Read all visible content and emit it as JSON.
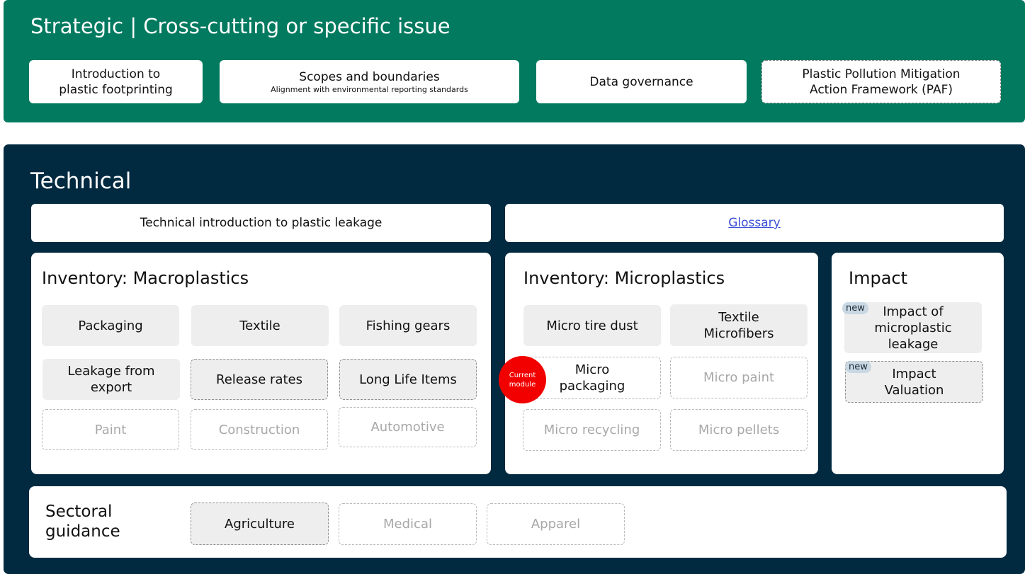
{
  "strategic": {
    "title": "Strategic | Cross-cutting or specific issue",
    "cards": [
      {
        "line1": "Introduction to",
        "line2": "plastic footprinting"
      },
      {
        "line1": "Scopes and boundaries",
        "sub": "Alignment with environmental reporting standards"
      },
      {
        "line1": "Data governance"
      },
      {
        "line1": "Plastic Pollution Mitigation",
        "line2": "Action Framework  (PAF)"
      }
    ]
  },
  "technical": {
    "title": "Technical",
    "intro": "Technical introduction to plastic leakage",
    "glossary": "Glossary",
    "macro": {
      "title": "Inventory: Macroplastics",
      "items": [
        {
          "l1": "Packaging"
        },
        {
          "l1": "Textile"
        },
        {
          "l1": "Fishing gears"
        },
        {
          "l1": "Leakage from",
          "l2": "export"
        },
        {
          "l1": "Release rates"
        },
        {
          "l1": "Long Life Items"
        },
        {
          "l1": "Paint"
        },
        {
          "l1": "Construction"
        },
        {
          "l1": "Automotive"
        }
      ]
    },
    "micro": {
      "title": "Inventory: Microplastics",
      "items": [
        {
          "l1": "Micro tire dust"
        },
        {
          "l1": "Textile",
          "l2": "Microfibers"
        },
        {
          "l1": "Micro",
          "l2": "packaging"
        },
        {
          "l1": "Micro paint"
        },
        {
          "l1": "Micro recycling"
        },
        {
          "l1": "Micro pellets"
        }
      ],
      "current_badge": {
        "l1": "Current",
        "l2": "module"
      }
    },
    "impact": {
      "title": "Impact",
      "items": [
        {
          "badge": "new",
          "l1": "Impact of",
          "l2": "microplastic",
          "l3": "leakage"
        },
        {
          "badge": "new",
          "l1": "Impact",
          "l2": "Valuation"
        }
      ]
    },
    "sectoral": {
      "title_l1": "Sectoral",
      "title_l2": "guidance",
      "items": [
        {
          "l1": "Agriculture"
        },
        {
          "l1": "Medical"
        },
        {
          "l1": "Apparel"
        }
      ]
    }
  },
  "colors": {
    "strategic_bg": "#027a5f",
    "technical_bg": "#012a40",
    "current_marker": "#f20000",
    "link": "#3a4fd6"
  }
}
